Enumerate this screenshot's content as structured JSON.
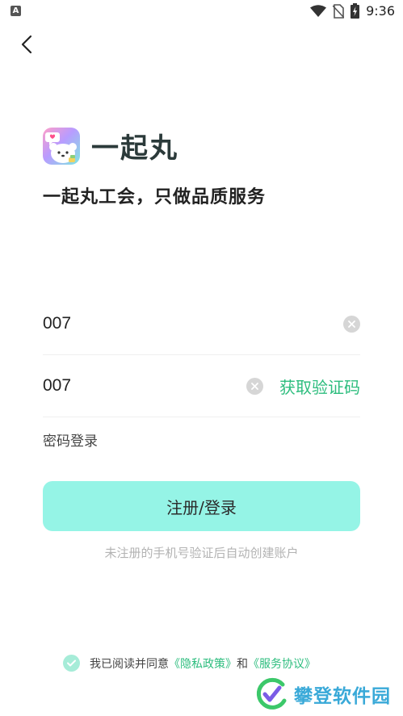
{
  "status_bar": {
    "app_badge": "A",
    "time": "9:36",
    "icons": [
      "wifi-icon",
      "no-sim-icon",
      "battery-charging-icon"
    ]
  },
  "nav": {
    "back_icon": "chevron-left-icon"
  },
  "brand": {
    "name": "一起丸",
    "logo_icon": "app-logo-icon",
    "slogan": "一起丸工会，只做品质服务"
  },
  "form": {
    "phone_value": "007",
    "code_value": "007",
    "get_code_label": "获取验证码",
    "password_login_label": "密码登录",
    "submit_label": "注册/登录",
    "hint": "未注册的手机号验证后自动创建账户"
  },
  "agreement": {
    "prefix": "我已阅读并同意",
    "privacy_link": "《隐私政策》",
    "and": "和",
    "service_link": "《服务协议》",
    "checked": true
  },
  "watermark": {
    "text": "攀登软件园"
  },
  "colors": {
    "accent_green": "#2dbd7e",
    "button_bg": "#95f4e6",
    "hint_gray": "#b3b3b3"
  }
}
